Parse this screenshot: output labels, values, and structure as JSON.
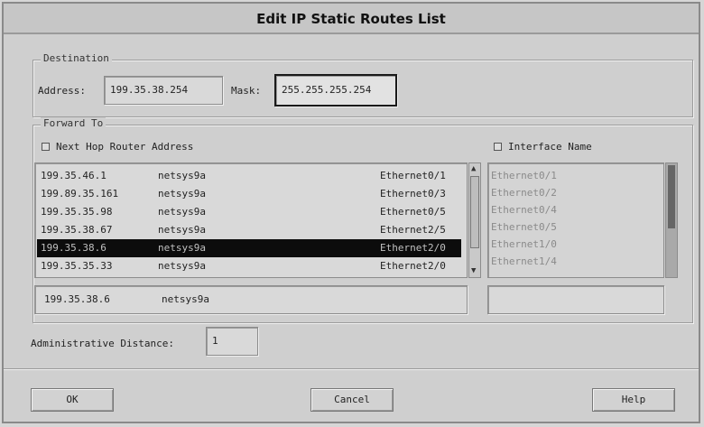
{
  "window": {
    "title": "Edit IP Static Routes List"
  },
  "destination": {
    "group_label": "Destination",
    "address_label": "Address:",
    "address_value": "199.35.38.254",
    "mask_label": "Mask:",
    "mask_value": "255.255.255.254"
  },
  "forward": {
    "group_label": "Forward To",
    "next_hop_label": "Next Hop Router Address",
    "interface_label": "Interface Name",
    "routes": [
      {
        "address": "199.35.46.1",
        "host": "netsys9a",
        "iface": "Ethernet0/1"
      },
      {
        "address": "199.89.35.161",
        "host": "netsys9a",
        "iface": "Ethernet0/3"
      },
      {
        "address": "199.35.35.98",
        "host": "netsys9a",
        "iface": "Ethernet0/5"
      },
      {
        "address": "199.35.38.67",
        "host": "netsys9a",
        "iface": "Ethernet2/5"
      },
      {
        "address": "199.35.38.6",
        "host": "netsys9a",
        "iface": "Ethernet2/0"
      },
      {
        "address": "199.35.35.33",
        "host": "netsys9a",
        "iface": "Ethernet2/0"
      }
    ],
    "selected_index": 4,
    "selected_address": "199.35.38.6",
    "selected_host": "netsys9a",
    "interfaces": [
      "Ethernet0/1",
      "Ethernet0/2",
      "Ethernet0/4",
      "Ethernet0/5",
      "Ethernet1/0",
      "Ethernet1/4"
    ],
    "interface_value": ""
  },
  "distance": {
    "label": "Administrative Distance:",
    "value": "1"
  },
  "buttons": {
    "ok": "OK",
    "cancel": "Cancel",
    "help": "Help"
  }
}
